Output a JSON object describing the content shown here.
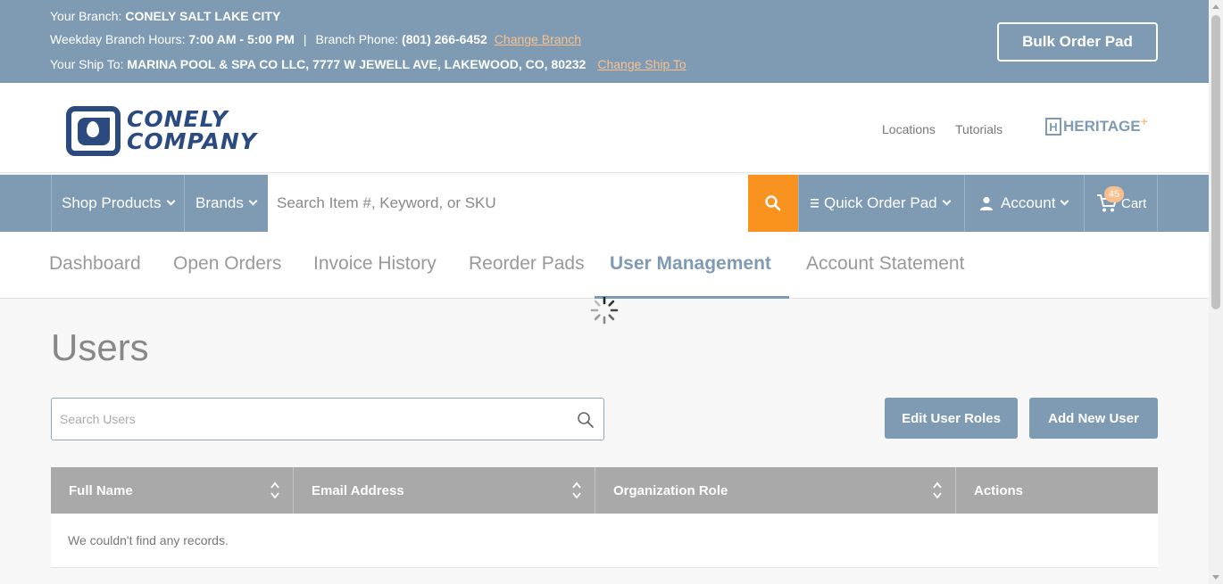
{
  "topbar": {
    "branch_label": "Your Branch: ",
    "branch_value": "CONELY SALT LAKE CITY",
    "hours_label": "Weekday Branch Hours: ",
    "hours_value": "7:00 AM - 5:00 PM",
    "separator": "|",
    "phone_label": "Branch Phone: ",
    "phone_value": "(801) 266-6452",
    "change_branch": "Change Branch",
    "shipto_label": "Your Ship To: ",
    "shipto_value": "MARINA POOL & SPA CO LLC, 7777 W JEWELL AVE, LAKEWOOD, CO, 80232",
    "change_shipto": "Change Ship To",
    "bulk_order_pad": "Bulk Order Pad"
  },
  "header": {
    "logo_line1": "CONELY",
    "logo_line2": "COMPANY",
    "locations": "Locations",
    "tutorials": "Tutorials",
    "heritage_mark": "H",
    "heritage_text": "HERITAGE",
    "heritage_plus": "+"
  },
  "nav": {
    "shop_products": "Shop Products",
    "brands": "Brands",
    "search_placeholder": "Search Item #, Keyword, or SKU",
    "quick_order_pad": "Quick Order Pad",
    "account": "Account",
    "cart": "Cart",
    "cart_count": "45"
  },
  "tabs": [
    {
      "label": "Dashboard"
    },
    {
      "label": "Open Orders"
    },
    {
      "label": "Invoice History"
    },
    {
      "label": "Reorder Pads"
    },
    {
      "label": "User Management"
    },
    {
      "label": "Account Statement"
    }
  ],
  "main": {
    "title": "Users",
    "search_placeholder": "Search Users",
    "edit_roles_button": "Edit User Roles",
    "add_user_button": "Add New User"
  },
  "table": {
    "columns": [
      "Full Name",
      "Email Address",
      "Organization Role",
      "Actions"
    ],
    "empty_message": "We couldn't find any records."
  },
  "colors": {
    "primary": "#7f9bb3",
    "accent": "#f7931e",
    "link": "#f9c08d",
    "logo": "#2b4b80",
    "table_header": "#a9a9a9"
  }
}
